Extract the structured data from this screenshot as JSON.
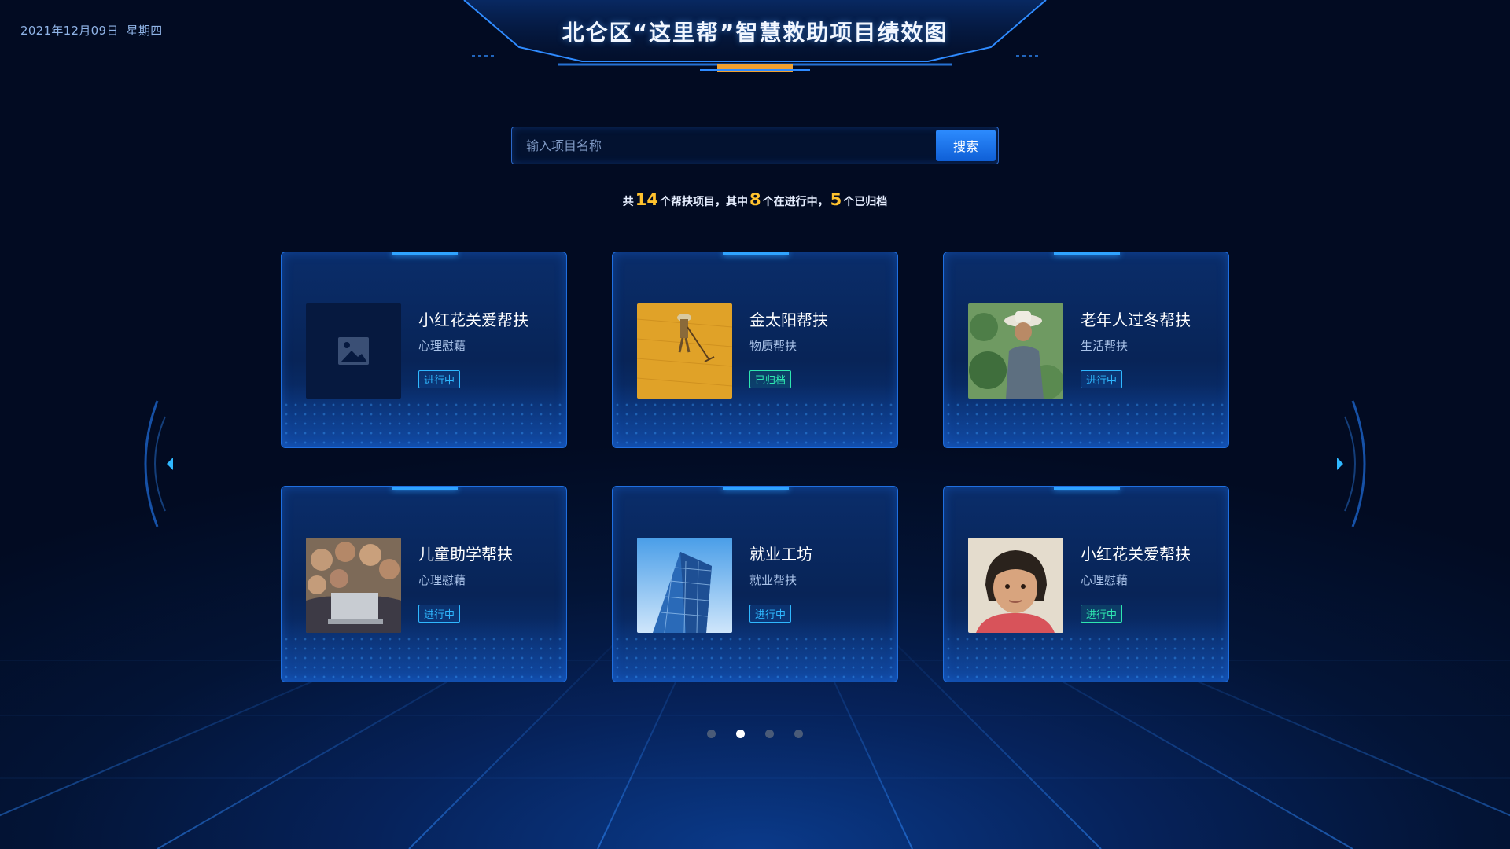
{
  "header": {
    "date": "2021年12月09日",
    "weekday": "星期四",
    "title": "北仑区“这里帮”智慧救助项目绩效图"
  },
  "search": {
    "placeholder": "输入项目名称",
    "value": "",
    "button_label": "搜索"
  },
  "summary": {
    "prefix": "共",
    "total": "14",
    "mid1": "个帮扶项目，其中",
    "active": "8",
    "mid2": "个在进行中，",
    "archived": "5",
    "suffix": "个已归档"
  },
  "projects": [
    {
      "name": "小红花关爱帮扶",
      "type": "心理慰藉",
      "status": "进行中",
      "image": "placeholder-image-icon"
    },
    {
      "name": "金太阳帮扶",
      "type": "物质帮扶",
      "status": "已归档",
      "image": "farmer-raking-photo"
    },
    {
      "name": "老年人过冬帮扶",
      "type": "生活帮扶",
      "status": "进行中",
      "image": "elderly-man-photo"
    },
    {
      "name": "儿童助学帮扶",
      "type": "心理慰藉",
      "status": "进行中",
      "image": "children-laptop-photo"
    },
    {
      "name": "就业工坊",
      "type": "就业帮扶",
      "status": "进行中",
      "image": "office-building-photo"
    },
    {
      "name": "小红花关爱帮扶",
      "type": "心理慰藉",
      "status": "进行中",
      "image": "child-portrait-photo"
    }
  ],
  "colors": {
    "active_badge": "#2fb8ff",
    "archived_badge": "#2ee6b0",
    "highlight_number": "#ffc22e",
    "card_border": "#1f6fe0"
  },
  "pager": {
    "pages": 4,
    "current": 2
  },
  "nav": {
    "prev_icon": "chevron-left-icon",
    "next_icon": "chevron-right-icon"
  }
}
